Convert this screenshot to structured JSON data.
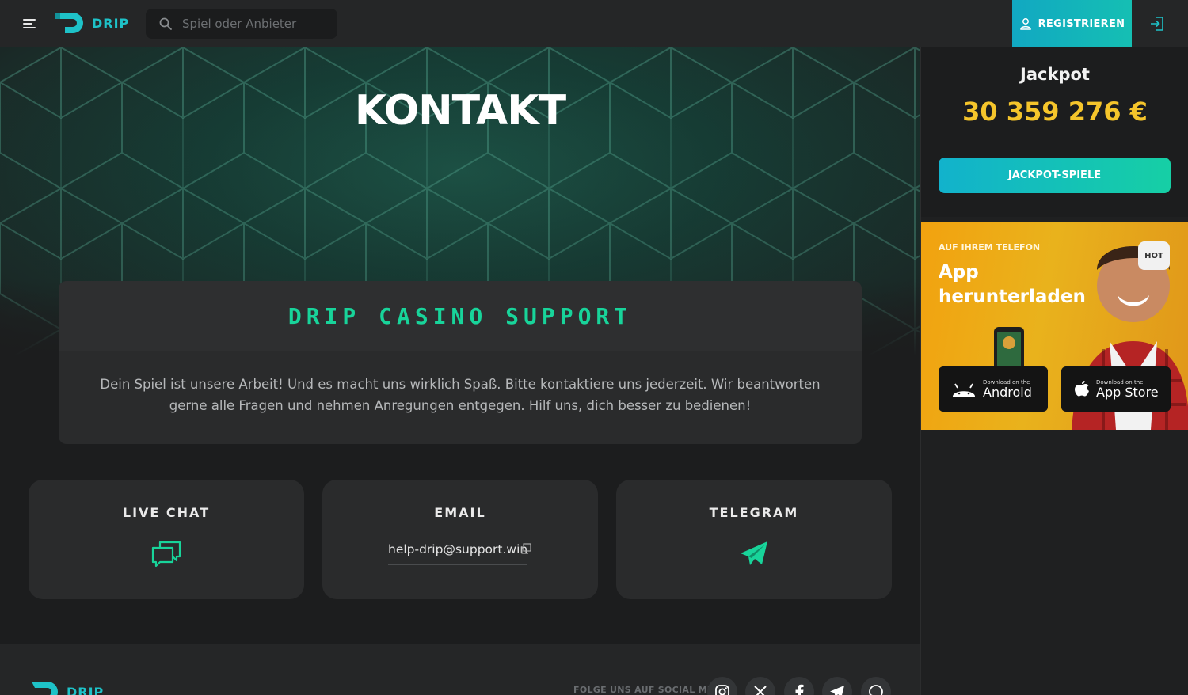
{
  "header": {
    "logo_text": "DRIP",
    "search_placeholder": "Spiel oder Anbieter",
    "register_label": "REGISTRIEREN"
  },
  "hero": {
    "title": "KONTAKT"
  },
  "support": {
    "heading": "DRIP CASINO SUPPORT",
    "text": "Dein Spiel ist unsere Arbeit! Und es macht uns wirklich Spaß. Bitte kontaktiere uns jederzeit. Wir beantworten gerne alle Fragen und nehmen Anregungen entgegen. Hilf uns, dich besser zu bedienen!"
  },
  "contact_cards": {
    "live_chat": "LIVE CHAT",
    "email": "EMAIL",
    "email_address": "help-drip@support.win",
    "telegram": "TELEGRAM"
  },
  "footer": {
    "logo_text": "DRIP",
    "follow_label": "FOLGE UNS AUF SOCIAL MEDIA",
    "social": [
      "instagram-icon",
      "x-icon",
      "facebook-icon",
      "telegram-icon",
      "whatsapp-icon"
    ]
  },
  "sidebar": {
    "jackpot_title": "Jackpot",
    "jackpot_amount": "30 359 276 €",
    "jackpot_button": "JACKPOT-SPIELE",
    "app_kicker": "AUF IHREM TELEFON",
    "app_title": "App herunterladen",
    "hot_badge": "HOT",
    "android_small": "Download on the",
    "android_big": "Android",
    "ios_small": "Download on the",
    "ios_big": "App Store"
  },
  "colors": {
    "accent_green": "#18d49a",
    "accent_teal": "#1ec2c8",
    "jackpot_gold": "#f5c52b"
  }
}
